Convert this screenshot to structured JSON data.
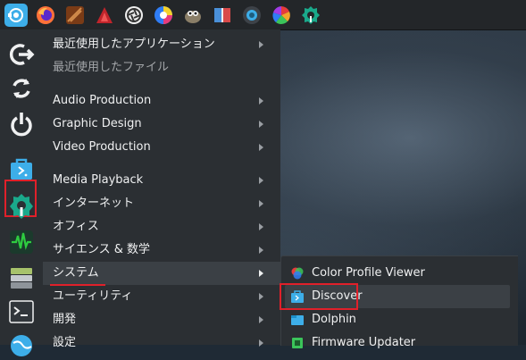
{
  "menu": {
    "items": [
      {
        "label": "最近使用したアプリケーション",
        "has_submenu": true,
        "dim": false
      },
      {
        "label": "最近使用したファイル",
        "has_submenu": false,
        "dim": true
      },
      {
        "label": "Audio Production",
        "has_submenu": true,
        "dim": false
      },
      {
        "label": "Graphic Design",
        "has_submenu": true,
        "dim": false
      },
      {
        "label": "Video Production",
        "has_submenu": true,
        "dim": false
      },
      {
        "label": "Media Playback",
        "has_submenu": true,
        "dim": false
      },
      {
        "label": "インターネット",
        "has_submenu": true,
        "dim": false
      },
      {
        "label": "オフィス",
        "has_submenu": true,
        "dim": false
      },
      {
        "label": "サイエンス & 数学",
        "has_submenu": true,
        "dim": false
      },
      {
        "label": "システム",
        "has_submenu": true,
        "dim": false,
        "active": true
      },
      {
        "label": "ユーティリティ",
        "has_submenu": true,
        "dim": false
      },
      {
        "label": "開発",
        "has_submenu": true,
        "dim": false
      },
      {
        "label": "設定",
        "has_submenu": true,
        "dim": false
      }
    ]
  },
  "submenu": {
    "items": [
      {
        "label": "Color Profile Viewer",
        "icon": "color-profile-icon"
      },
      {
        "label": "Discover",
        "icon": "discover-icon",
        "selected": true
      },
      {
        "label": "Dolphin",
        "icon": "dolphin-icon"
      },
      {
        "label": "Firmware Updater",
        "icon": "firmware-icon"
      }
    ]
  },
  "favorites": [
    {
      "icon": "logout-icon"
    },
    {
      "icon": "restart-icon"
    },
    {
      "icon": "power-icon"
    },
    {
      "icon": "discover-icon",
      "highlighted": true
    },
    {
      "icon": "system-settings-icon"
    },
    {
      "icon": "system-monitor-icon"
    },
    {
      "icon": "disk-stack-icon"
    },
    {
      "icon": "terminal-icon"
    },
    {
      "icon": "globe-icon"
    }
  ],
  "taskbar": {
    "icons": [
      "app-launcher-icon",
      "firefox-icon",
      "game-icon",
      "red-triangle-icon",
      "aperture-icon",
      "color-wheel-icon",
      "gimp-icon",
      "book-icon",
      "circle-app-icon",
      "color-picker-icon",
      "settings-gear-icon"
    ]
  },
  "colors": {
    "accent": "#3daee9",
    "highlight": "#e0202a",
    "menu_bg": "#2b2f33",
    "text": "#eff0f1"
  }
}
